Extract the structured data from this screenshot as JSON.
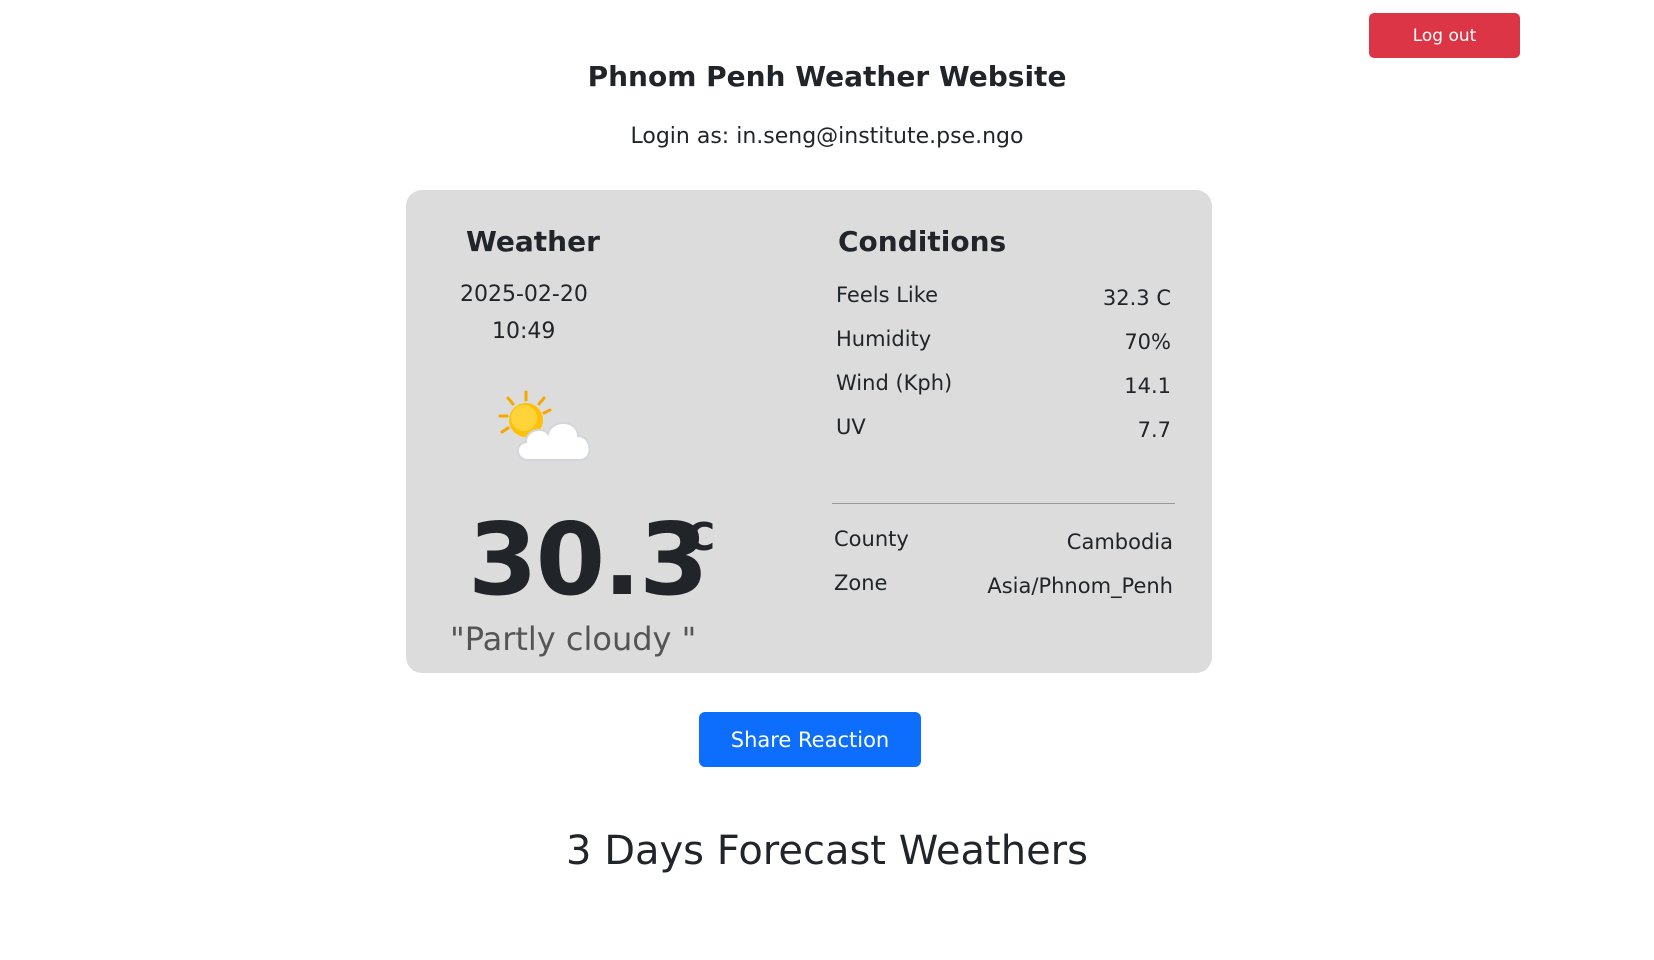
{
  "header": {
    "logout_label": "Log out",
    "site_title": "Phnom Penh Weather Website",
    "login_text": "Login as: in.seng@institute.pse.ngo"
  },
  "weather": {
    "heading": "Weather",
    "date": "2025-02-20",
    "time": "10:49",
    "icon": "partly-cloudy-icon",
    "temperature": "30.3",
    "unit": "°C",
    "condition": "\"Partly cloudy \""
  },
  "conditions": {
    "heading": "Conditions",
    "rows": [
      {
        "label": "Feels Like",
        "value": "32.3 C"
      },
      {
        "label": "Humidity",
        "value": "70%"
      },
      {
        "label": "Wind (Kph)",
        "value": "14.1"
      },
      {
        "label": "UV",
        "value": "7.7"
      }
    ],
    "location": [
      {
        "label": "County",
        "value": "Cambodia"
      },
      {
        "label": "Zone",
        "value": "Asia/Phnom_Penh"
      }
    ]
  },
  "actions": {
    "share_label": "Share Reaction"
  },
  "forecast": {
    "heading": "3 Days Forecast Weathers"
  },
  "colors": {
    "logout": "#dc3545",
    "share": "#0d6efd",
    "card_bg": "#dcdcdc"
  }
}
